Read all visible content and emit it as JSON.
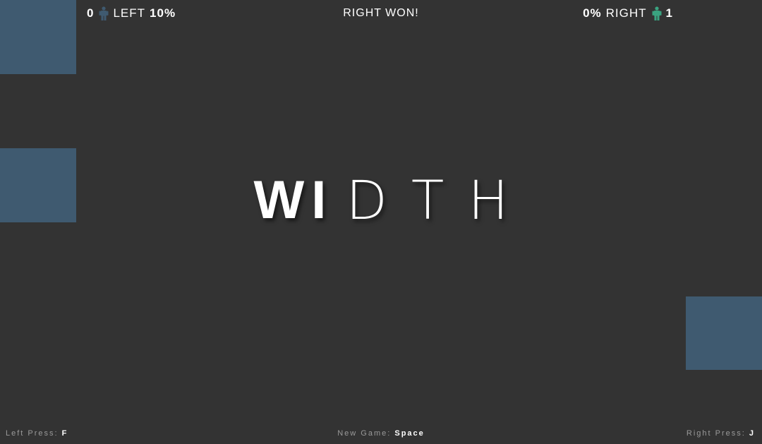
{
  "hud": {
    "left": {
      "score": "0",
      "label": "LEFT",
      "percent": "10%",
      "icon": "person-icon",
      "color": "#3f5a70"
    },
    "right": {
      "percent": "0%",
      "label": "RIGHT",
      "score": "1",
      "icon": "person-icon",
      "color": "#3aa380"
    },
    "status": "RIGHT WON!"
  },
  "title": {
    "letters": [
      "W",
      "I",
      "D",
      "T",
      "H"
    ]
  },
  "controls": {
    "left_label": "Left Press:",
    "left_key": "F",
    "new_game_label": "New Game:",
    "new_game_key": "Space",
    "right_label": "Right Press:",
    "right_key": "J"
  },
  "colors": {
    "background": "#333333",
    "block": "#3f5a70",
    "left_player": "#3f5a70",
    "right_player": "#3aa380"
  }
}
